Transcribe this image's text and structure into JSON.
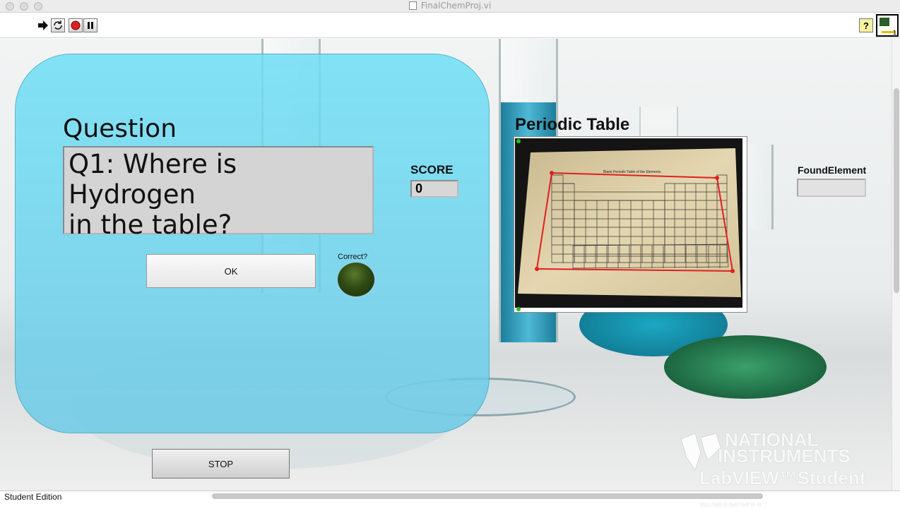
{
  "window": {
    "title": "FinalChemProj.vi"
  },
  "toolbar": {
    "run_icon": "run-arrow-icon",
    "run_continuous_icon": "run-continuously-icon",
    "abort_icon": "abort-icon",
    "pause_icon": "pause-icon",
    "help_label": "?",
    "vi_icon_number": "1"
  },
  "question": {
    "label": "Question",
    "text_line1": "Q1: Where is Hydrogen",
    "text_line2": "in the table?"
  },
  "ok_button": {
    "label": "OK"
  },
  "correct_indicator": {
    "label": "Correct?",
    "state": "off",
    "color": "#2f4a14"
  },
  "score": {
    "label": "SCORE",
    "value": "0"
  },
  "periodic_table": {
    "label": "Periodic Table",
    "sheet_title": "Blank Periodic Table of the Elements",
    "detection_color": "#e02020"
  },
  "found_element": {
    "label": "FoundElement",
    "value": ""
  },
  "stop_button": {
    "label": "STOP"
  },
  "watermark": {
    "line1": "NATIONAL",
    "line2": "INSTRUMENTS",
    "line3": "LabVIEW™Student Edition"
  },
  "status": {
    "text": "Student Edition"
  }
}
